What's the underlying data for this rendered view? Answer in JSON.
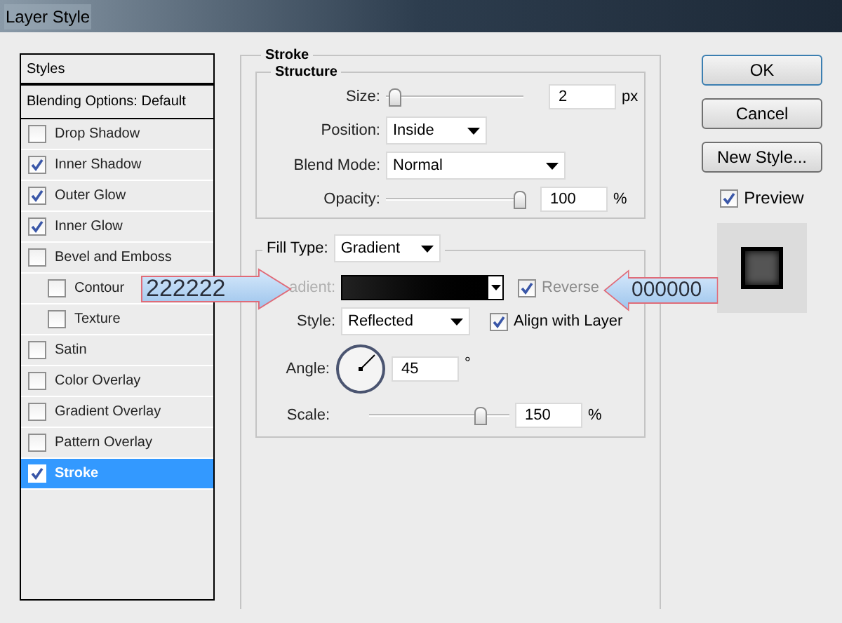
{
  "window": {
    "title": "Layer Style"
  },
  "styles_panel": {
    "header": "Styles",
    "blending_options": "Blending Options: Default",
    "items": [
      {
        "label": "Drop Shadow",
        "checked": false,
        "selected": false
      },
      {
        "label": "Inner Shadow",
        "checked": true,
        "selected": false
      },
      {
        "label": "Outer Glow",
        "checked": true,
        "selected": false
      },
      {
        "label": "Inner Glow",
        "checked": true,
        "selected": false
      },
      {
        "label": "Bevel and Emboss",
        "checked": false,
        "selected": false,
        "children": [
          {
            "label": "Contour",
            "checked": false,
            "selected": false
          },
          {
            "label": "Texture",
            "checked": false,
            "selected": false
          }
        ]
      },
      {
        "label": "Satin",
        "checked": false,
        "selected": false
      },
      {
        "label": "Color Overlay",
        "checked": false,
        "selected": false
      },
      {
        "label": "Gradient Overlay",
        "checked": false,
        "selected": false
      },
      {
        "label": "Pattern Overlay",
        "checked": false,
        "selected": false
      },
      {
        "label": "Stroke",
        "checked": true,
        "selected": true
      }
    ]
  },
  "stroke": {
    "title": "Stroke",
    "structure": {
      "title": "Structure",
      "size": {
        "label": "Size:",
        "level": 0.02,
        "value": "2",
        "unit": "px"
      },
      "position": {
        "label": "Position:",
        "value": "Inside"
      },
      "blend_mode": {
        "label": "Blend Mode:",
        "value": "Normal"
      },
      "opacity": {
        "label": "Opacity:",
        "level": 1,
        "value": "100",
        "unit": "%"
      }
    },
    "fill": {
      "label": "Fill Type:",
      "value": "Gradient",
      "gradient": {
        "label": "adient:"
      },
      "reverse": {
        "label": "Reverse",
        "checked": true
      },
      "style": {
        "label": "Style:",
        "value": "Reflected"
      },
      "align": {
        "label": "Align with Layer",
        "checked": true
      },
      "angle": {
        "label": "Angle:",
        "value": "45",
        "unit": "°"
      },
      "scale": {
        "label": "Scale:",
        "level": 0.82,
        "value": "150",
        "unit": "%"
      }
    }
  },
  "buttons": [
    "OK",
    "Cancel",
    "New Style..."
  ],
  "preview": {
    "label": "Preview",
    "checked": true
  },
  "callouts": [
    "222222",
    "000000"
  ]
}
